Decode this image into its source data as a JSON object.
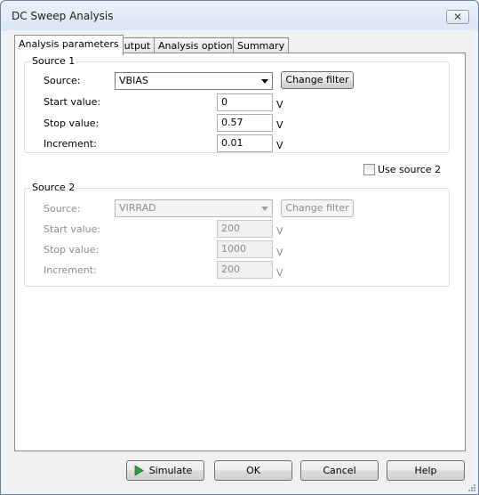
{
  "window": {
    "title": "DC Sweep Analysis",
    "close_glyph": "✕"
  },
  "tabs": [
    {
      "label": "Analysis parameters",
      "active": true
    },
    {
      "label": "Output",
      "active": false
    },
    {
      "label": "Analysis options",
      "active": false
    },
    {
      "label": "Summary",
      "active": false
    }
  ],
  "source1": {
    "group_label": "Source 1",
    "source_label": "Source:",
    "source_value": "VBIAS",
    "change_filter": "Change filter",
    "start_label": "Start value:",
    "start_value": "0",
    "stop_label": "Stop value:",
    "stop_value": "0.57",
    "increment_label": "Increment:",
    "increment_value": "0.01",
    "unit": "V"
  },
  "use_source2": {
    "label": "Use source 2",
    "checked": false
  },
  "source2": {
    "group_label": "Source 2",
    "source_label": "Source:",
    "source_value": "VIRRAD",
    "change_filter": "Change filter",
    "start_label": "Start value:",
    "start_value": "200",
    "stop_label": "Stop value:",
    "stop_value": "1000",
    "increment_label": "Increment:",
    "increment_value": "200",
    "unit": "V",
    "enabled": false
  },
  "buttons": {
    "simulate": "Simulate",
    "ok": "OK",
    "cancel": "Cancel",
    "help": "Help"
  },
  "colors": {
    "simulate_icon": "#2ea043",
    "panel_bg": "#ffffff",
    "window_bg": "#f0f0f0"
  },
  "icons": {
    "close": "close-icon",
    "simulate": "play-icon",
    "dropdown": "chevron-down-icon"
  }
}
